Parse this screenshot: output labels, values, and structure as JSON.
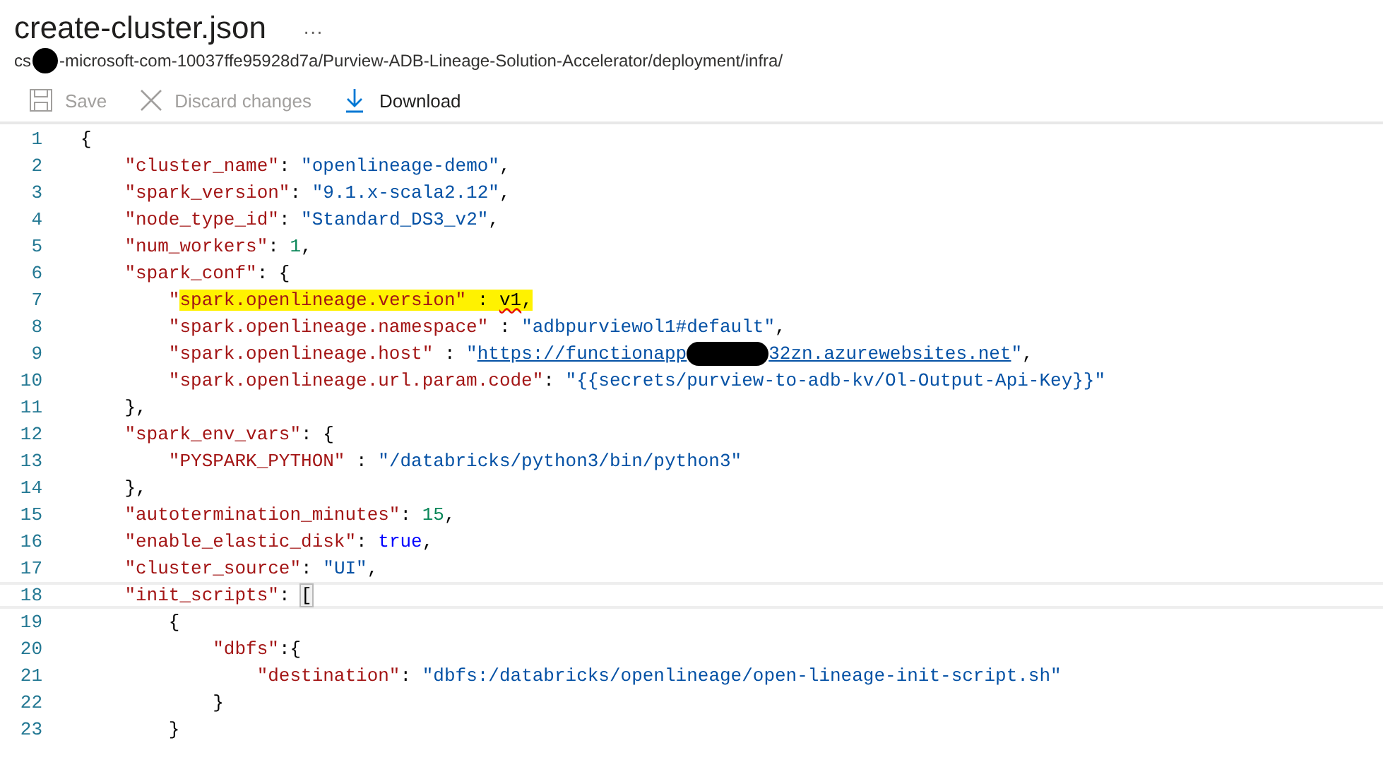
{
  "title": "create-cluster.json",
  "more": "···",
  "path": {
    "before": "cs",
    "after": "-microsoft-com-10037ffe95928d7a/Purview-ADB-Lineage-Solution-Accelerator/deployment/infra/",
    "redacted": true
  },
  "toolbar": [
    {
      "kind": "save",
      "label": "Save",
      "disabled": true
    },
    {
      "kind": "discard",
      "label": "Discard changes",
      "disabled": true
    },
    {
      "kind": "download",
      "label": "Download",
      "disabled": false
    }
  ],
  "lines": [
    {
      "number": "1",
      "current": false,
      "tokens": [
        {
          "kind": "punct",
          "text": "{"
        }
      ]
    },
    {
      "number": "2",
      "current": false,
      "tokens": [
        {
          "kind": "key",
          "text": "    \"cluster_name\""
        },
        {
          "kind": "punct",
          "text": ": "
        },
        {
          "kind": "str",
          "text": "\"openlineage-demo\""
        },
        {
          "kind": "punct",
          "text": ","
        }
      ]
    },
    {
      "number": "3",
      "current": false,
      "tokens": [
        {
          "kind": "key",
          "text": "    \"spark_version\""
        },
        {
          "kind": "punct",
          "text": ": "
        },
        {
          "kind": "str",
          "text": "\"9.1.x-scala2.12\""
        },
        {
          "kind": "punct",
          "text": ","
        }
      ]
    },
    {
      "number": "4",
      "current": false,
      "tokens": [
        {
          "kind": "key",
          "text": "    \"node_type_id\""
        },
        {
          "kind": "punct",
          "text": ": "
        },
        {
          "kind": "str",
          "text": "\"Standard_DS3_v2\""
        },
        {
          "kind": "punct",
          "text": ","
        }
      ]
    },
    {
      "number": "5",
      "current": false,
      "tokens": [
        {
          "kind": "key",
          "text": "    \"num_workers\""
        },
        {
          "kind": "punct",
          "text": ": "
        },
        {
          "kind": "num",
          "text": "1"
        },
        {
          "kind": "punct",
          "text": ","
        }
      ]
    },
    {
      "number": "6",
      "current": false,
      "tokens": [
        {
          "kind": "key",
          "text": "    \"spark_conf\""
        },
        {
          "kind": "punct",
          "text": ": {"
        }
      ]
    },
    {
      "number": "7",
      "current": false,
      "tokens": [
        {
          "kind": "key",
          "text": "        \""
        },
        {
          "kind": "key",
          "text": "spark.openlineage.version\"",
          "highlighted": true
        },
        {
          "kind": "punct",
          "text": " : ",
          "highlighted": true
        },
        {
          "kind": "punct",
          "text": "v1",
          "highlighted": true,
          "error": true
        },
        {
          "kind": "punct",
          "text": ",",
          "highlighted": true
        }
      ]
    },
    {
      "number": "8",
      "current": false,
      "tokens": [
        {
          "kind": "key",
          "text": "        \"spark.openlineage.namespace\""
        },
        {
          "kind": "punct",
          "text": " : "
        },
        {
          "kind": "str",
          "text": "\"adbpurviewol1#default\""
        },
        {
          "kind": "punct",
          "text": ","
        }
      ]
    },
    {
      "number": "9",
      "current": false,
      "tokens": [
        {
          "kind": "key",
          "text": "        \"spark.openlineage.host\""
        },
        {
          "kind": "punct",
          "text": " : "
        },
        {
          "kind": "str",
          "text": "\""
        },
        {
          "kind": "link",
          "text": "https://functionapp"
        },
        {
          "kind": "redaction"
        },
        {
          "kind": "link",
          "text": "32zn.azurewebsites.net"
        },
        {
          "kind": "str",
          "text": "\""
        },
        {
          "kind": "punct",
          "text": ","
        }
      ]
    },
    {
      "number": "10",
      "current": false,
      "tokens": [
        {
          "kind": "key",
          "text": "        \"spark.openlineage.url.param.code\""
        },
        {
          "kind": "punct",
          "text": ": "
        },
        {
          "kind": "str",
          "text": "\"{{secrets/purview-to-adb-kv/Ol-Output-Api-Key}}\""
        }
      ]
    },
    {
      "number": "11",
      "current": false,
      "tokens": [
        {
          "kind": "punct",
          "text": "    },"
        }
      ]
    },
    {
      "number": "12",
      "current": false,
      "tokens": [
        {
          "kind": "key",
          "text": "    \"spark_env_vars\""
        },
        {
          "kind": "punct",
          "text": ": {"
        }
      ]
    },
    {
      "number": "13",
      "current": false,
      "tokens": [
        {
          "kind": "key",
          "text": "        \"PYSPARK_PYTHON\""
        },
        {
          "kind": "punct",
          "text": " : "
        },
        {
          "kind": "str",
          "text": "\"/databricks/python3/bin/python3\""
        }
      ]
    },
    {
      "number": "14",
      "current": false,
      "tokens": [
        {
          "kind": "punct",
          "text": "    },"
        }
      ]
    },
    {
      "number": "15",
      "current": false,
      "tokens": [
        {
          "kind": "key",
          "text": "    \"autotermination_minutes\""
        },
        {
          "kind": "punct",
          "text": ": "
        },
        {
          "kind": "num",
          "text": "15"
        },
        {
          "kind": "punct",
          "text": ","
        }
      ]
    },
    {
      "number": "16",
      "current": false,
      "tokens": [
        {
          "kind": "key",
          "text": "    \"enable_elastic_disk\""
        },
        {
          "kind": "punct",
          "text": ": "
        },
        {
          "kind": "bool",
          "text": "true"
        },
        {
          "kind": "punct",
          "text": ","
        }
      ]
    },
    {
      "number": "17",
      "current": false,
      "tokens": [
        {
          "kind": "key",
          "text": "    \"cluster_source\""
        },
        {
          "kind": "punct",
          "text": ": "
        },
        {
          "kind": "str",
          "text": "\"UI\""
        },
        {
          "kind": "punct",
          "text": ","
        }
      ]
    },
    {
      "number": "18",
      "current": true,
      "tokens": [
        {
          "kind": "key",
          "text": "    \"init_scripts\""
        },
        {
          "kind": "punct",
          "text": ": "
        },
        {
          "kind": "punct",
          "text": "[",
          "matched": true
        }
      ]
    },
    {
      "number": "19",
      "current": false,
      "tokens": [
        {
          "kind": "punct",
          "text": "        {"
        }
      ]
    },
    {
      "number": "20",
      "current": false,
      "tokens": [
        {
          "kind": "key",
          "text": "            \"dbfs\""
        },
        {
          "kind": "punct",
          "text": ":{"
        }
      ]
    },
    {
      "number": "21",
      "current": false,
      "tokens": [
        {
          "kind": "key",
          "text": "                \"destination\""
        },
        {
          "kind": "punct",
          "text": ": "
        },
        {
          "kind": "str",
          "text": "\"dbfs:/databricks/openlineage/open-lineage-init-script.sh\""
        }
      ]
    },
    {
      "number": "22",
      "current": false,
      "tokens": [
        {
          "kind": "punct",
          "text": "            }"
        }
      ]
    },
    {
      "number": "23",
      "current": false,
      "tokens": [
        {
          "kind": "punct",
          "text": "        }"
        }
      ]
    }
  ]
}
